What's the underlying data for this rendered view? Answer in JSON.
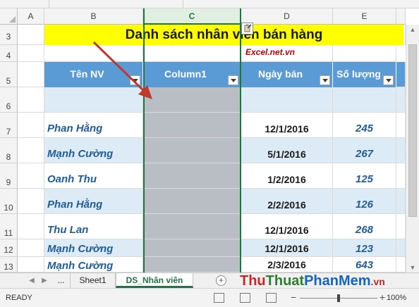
{
  "columns": [
    "A",
    "B",
    "C",
    "D",
    "E"
  ],
  "rows": [
    "3",
    "4",
    "5",
    "6",
    "7",
    "8",
    "9",
    "10",
    "11",
    "12",
    "13"
  ],
  "title": "Danh sách nhân viên bán hàng",
  "brand": "Excel.net.vn",
  "table": {
    "headers": [
      "Tên NV",
      "Column1",
      "Ngày bán",
      "Số lượng"
    ],
    "records": [
      {
        "name": "",
        "date": "",
        "qty": ""
      },
      {
        "name": "Phan Hằng",
        "date": "12/1/2016",
        "qty": "245"
      },
      {
        "name": "Mạnh Cường",
        "date": "5/1/2016",
        "qty": "267"
      },
      {
        "name": "Oanh Thu",
        "date": "1/2/2016",
        "qty": "125"
      },
      {
        "name": "Phan Hằng",
        "date": "2/2/2016",
        "qty": "126"
      },
      {
        "name": "Thu Lan",
        "date": "12/1/2016",
        "qty": "268"
      },
      {
        "name": "Mạnh Cường",
        "date": "12/1/2016",
        "qty": "123"
      },
      {
        "name": "Mạnh Cường",
        "date": "2/3/2016",
        "qty": "643"
      }
    ]
  },
  "sheet_tabs": {
    "more": "...",
    "sheet1": "Sheet1",
    "active": "DS_Nhân viên"
  },
  "status": {
    "ready": "READY",
    "zoom": "100%"
  },
  "watermark": {
    "part1": "Thu",
    "part2": "Thuat",
    "part3": "PhanMem",
    "part4": ".vn"
  },
  "colors": {
    "title_fill": "#ffff00",
    "header_fill": "#5b9bd5",
    "band_fill": "#ddebf7",
    "selection": "#217346",
    "arrow": "#c0392b"
  }
}
